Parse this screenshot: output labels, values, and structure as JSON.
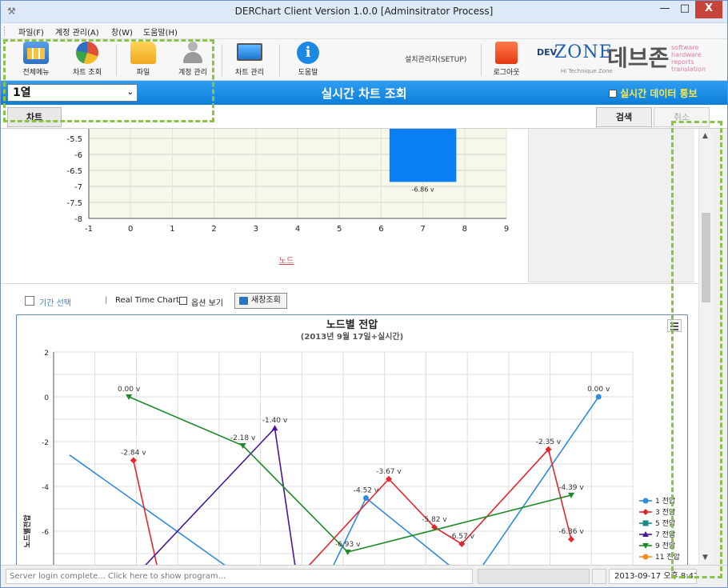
{
  "window": {
    "title": "DERChart Client Version 1.0.0 [Adminsitrator Process]",
    "min_glyph": "—",
    "max_glyph": "□",
    "close_glyph": "X"
  },
  "menu": [
    "파일(F)",
    "계정 관리(A)",
    "창(W)",
    "도움말(H)"
  ],
  "toolbar": {
    "items": [
      {
        "label": "전체메뉴",
        "icon": "grid-menu-icon",
        "color": "#3b7fd1"
      },
      {
        "label": "차트 조회",
        "icon": "pie-chart-icon",
        "color": "#e04e3a"
      },
      {
        "label": "파일",
        "icon": "folder-icon",
        "color": "#f2b92a"
      },
      {
        "label": "계정 관리",
        "icon": "user-icon",
        "color": "#9a9a9a"
      },
      {
        "label": "차트 관리",
        "icon": "monitor-icon",
        "color": "#2b8fe2"
      },
      {
        "label": "도움말",
        "icon": "info-icon",
        "color": "#1e88e5"
      }
    ],
    "setup_label": "설치관리자(SETUP)",
    "logout_label": "로그아웃",
    "logout_color": "#ee4a1c"
  },
  "logo": {
    "dev": "DEV",
    "zone": "ZONE",
    "tagline": "Hi Technique Zone",
    "brand_ko": "데브존",
    "sub_lines": [
      "software",
      "hardware",
      "reports",
      "translation"
    ]
  },
  "header": {
    "column_select": "1열",
    "title": "실시간 차트 조회",
    "realtime_notify_label": "실시간 데이터 통보"
  },
  "tabs": {
    "chart_tab": "차트",
    "search_button": "검색",
    "cancel_button": "취소"
  },
  "options": {
    "period_label": "기간 선택",
    "separator": "|",
    "realtime_chart_label": "Real Time Chart",
    "show_options_label": "옵션 보기",
    "new_search_label": "새창조회"
  },
  "status": {
    "message": "Server login complete... Click here to show program...",
    "datetime": "2013-09-17 오후 8:42"
  },
  "colors": {
    "header_blue": "#0d7fd8",
    "notify_yellow": "#ffe84a",
    "bar_blue": "#0a7ef5"
  },
  "chart_data": [
    {
      "type": "bar",
      "x": [
        7
      ],
      "values": [
        -6.86
      ],
      "data_labels": [
        "-6.86 v"
      ],
      "xlabel": "노드",
      "xlim": [
        -1,
        9
      ],
      "xticks": [
        -1,
        0,
        1,
        2,
        3,
        4,
        5,
        6,
        7,
        8,
        9
      ],
      "yticks": [
        -5.5,
        -6,
        -6.5,
        -7,
        -7.5,
        -8
      ],
      "ylim_visible": [
        -8,
        -5.2
      ],
      "grid": true
    },
    {
      "type": "line",
      "title": "노드별 전압",
      "subtitle": "(2013년 9월 17일+실시간)",
      "ylabel": "노드별전압",
      "yticks": [
        2,
        0,
        -2,
        -4,
        -6
      ],
      "ylim_visible": [
        -8.3,
        2
      ],
      "grid": true,
      "legend_position": "right",
      "series": [
        {
          "name": "1 전압",
          "color": "#2f8ae2",
          "marker": "circle",
          "x": [
            0,
            3.6,
            5.6,
            6.5,
            8.8,
            11.6
          ],
          "y": [
            -2.6,
            -7.8,
            -8.3,
            -4.52,
            -8.3,
            0.0
          ],
          "labels": [
            null,
            null,
            null,
            "-4.52 v",
            null,
            "0.00 v"
          ]
        },
        {
          "name": "3 전압",
          "color": "#e3272c",
          "marker": "diamond",
          "x": [
            1.4,
            2.0,
            4.9,
            7.0,
            8.0,
            8.6,
            10.5,
            11.0
          ],
          "y": [
            -2.84,
            -8.3,
            -8.3,
            -3.67,
            -5.82,
            -6.57,
            -2.35,
            -6.36
          ],
          "labels": [
            "-2.84 v",
            null,
            null,
            "-3.67 v",
            "-5.82 v",
            "-6.57 v",
            "-2.35 v",
            "-6.36 v"
          ]
        },
        {
          "name": "5 전압",
          "color": "#1a8a8a",
          "marker": "square",
          "x": [],
          "y": [],
          "labels": []
        },
        {
          "name": "7 전압",
          "color": "#47169c",
          "marker": "triangle-up",
          "x": [
            1.3,
            4.5,
            5.0
          ],
          "y": [
            -8.3,
            -1.4,
            -8.3
          ],
          "labels": [
            null,
            "-1.40 v",
            null
          ]
        },
        {
          "name": "9 전압",
          "color": "#1e8a2a",
          "marker": "triangle-down",
          "x": [
            1.3,
            3.8,
            6.1,
            11.0
          ],
          "y": [
            0.0,
            -2.18,
            -6.93,
            -4.39
          ],
          "labels": [
            "0.00 v",
            "-2.18 v",
            "-6.93 v",
            "-4.39 v"
          ]
        },
        {
          "name": "11 전압",
          "color": "#f28c1c",
          "marker": "circle",
          "x": [],
          "y": [],
          "labels": []
        }
      ]
    }
  ]
}
